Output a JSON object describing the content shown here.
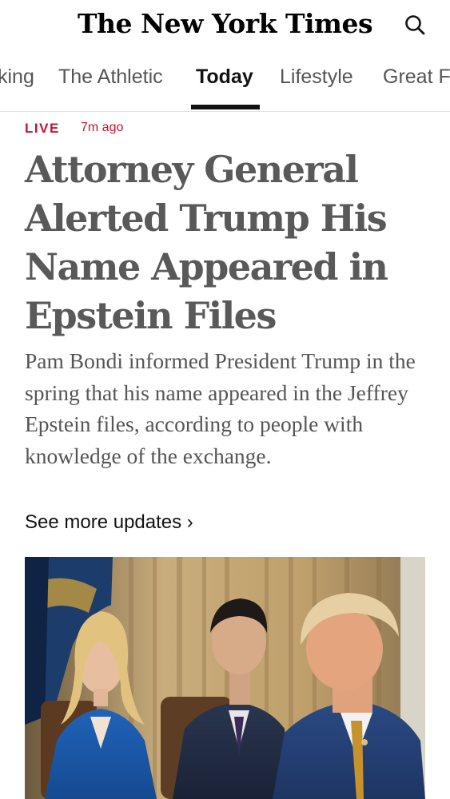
{
  "header": {
    "logo_text": "The New York Times",
    "search_icon": "search-icon"
  },
  "nav": {
    "tabs": [
      {
        "label": "king"
      },
      {
        "label": "The Athletic"
      },
      {
        "label": "Today",
        "active": true
      },
      {
        "label": "Lifestyle"
      },
      {
        "label": "Great F"
      }
    ]
  },
  "article": {
    "live_label": "LIVE",
    "timestamp": "7m ago",
    "headline": "Attorney General Alerted Trump His Name Appeared in Epstein Files",
    "summary": "Pam Bondi informed President Trump in the spring that his name appeared in the Jeffrey Epstein files, according to people with knowledge of the exchange.",
    "more_link": "See more updates ›"
  },
  "colors": {
    "live_red": "#c4122f",
    "headline_gray": "#595959",
    "summary_gray": "#555555",
    "text_dark": "#121212"
  }
}
